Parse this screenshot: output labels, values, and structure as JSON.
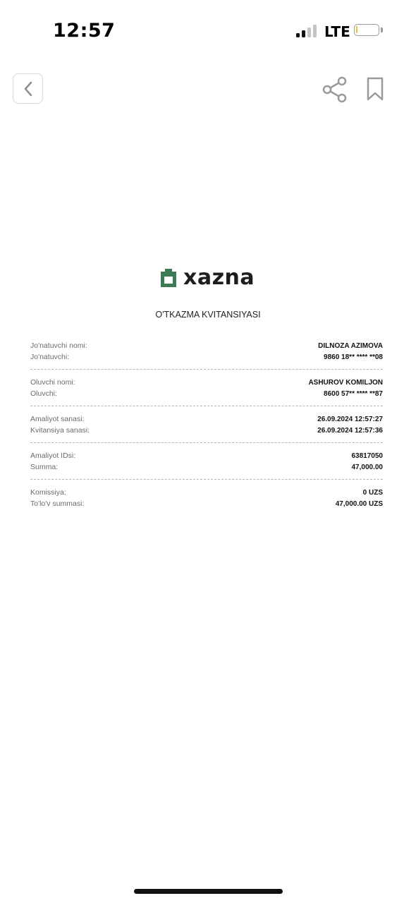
{
  "status_bar": {
    "time": "12:57",
    "network": "LTE"
  },
  "header": {
    "back_icon": "chevron-left-icon",
    "share_icon": "share-icon",
    "bookmark_icon": "bookmark-icon"
  },
  "brand": {
    "name": "xazna",
    "color": "#3f7a56"
  },
  "receipt": {
    "title": "O'TKAZMA KVITANSIYASI",
    "groups": [
      [
        {
          "label": "Jo'natuvchi nomi:",
          "value": "DILNOZA AZIMOVA"
        },
        {
          "label": "Jo'natuvchi:",
          "value": "9860 18** **** **08"
        }
      ],
      [
        {
          "label": "Oluvchi nomi:",
          "value": "ASHUROV KOMILJON"
        },
        {
          "label": "Oluvchi:",
          "value": "8600 57** **** **87"
        }
      ],
      [
        {
          "label": "Amaliyot sanasi:",
          "value": "26.09.2024 12:57:27"
        },
        {
          "label": "Kvitansiya sanasi:",
          "value": "26.09.2024 12:57:36"
        }
      ],
      [
        {
          "label": "Amaliyot IDsi:",
          "value": "63817050"
        },
        {
          "label": "Summa:",
          "value": "47,000.00"
        }
      ],
      [
        {
          "label": "Komissiya:",
          "value": "0 UZS"
        },
        {
          "label": "To'lo'v summasi:",
          "value": "47,000.00 UZS"
        }
      ]
    ]
  }
}
